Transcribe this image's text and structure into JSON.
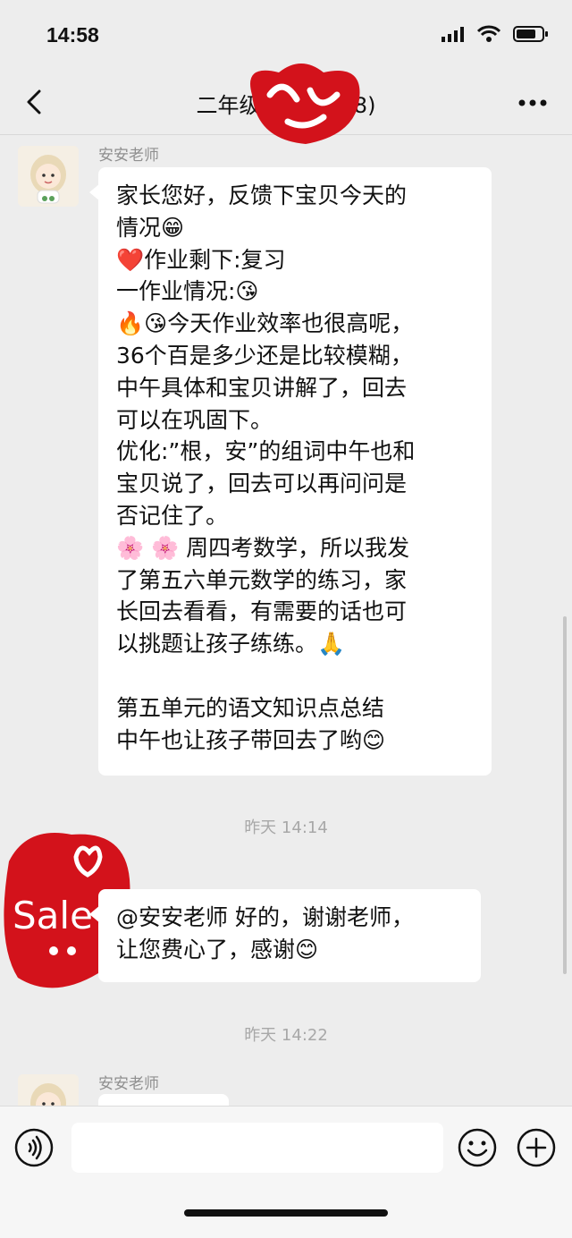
{
  "status_bar": {
    "time": "14:58"
  },
  "nav": {
    "title": "二年级1班 流群(8)"
  },
  "messages": [
    {
      "sender": "安安老师",
      "lines": [
        "家长您好，反馈下宝贝今天的",
        "情况😁",
        "❤️作业剩下:复习",
        "一作业情况:😘",
        "🔥😘今天作业效率也很高呢，",
        "36个百是多少还是比较模糊，",
        "中午具体和宝贝讲解了，回去",
        "可以在巩固下。",
        "优化:”根，安”的组词中午也和",
        "宝贝说了，回去可以再问问是",
        "否记住了。",
        "🌸 🌸 周四考数学，所以我发",
        "了第五六单元数学的练习，家",
        "长回去看看，有需要的话也可",
        "以挑题让孩子练练。🙏",
        "",
        "第五单元的语文知识点总结",
        "中午也让孩子带回去了哟😊"
      ]
    },
    {
      "timestamp": "昨天 14:14"
    },
    {
      "sender": "",
      "lines": [
        "@安安老师 好的，谢谢老师，",
        "让您费心了，感谢😊"
      ]
    },
    {
      "timestamp": "昨天 14:22"
    },
    {
      "sender": "安安老师",
      "lines": []
    }
  ],
  "sticker_text": "Sale",
  "colors": {
    "background": "#ededed",
    "bubble": "#ffffff",
    "sticker_red": "#d3121b"
  }
}
